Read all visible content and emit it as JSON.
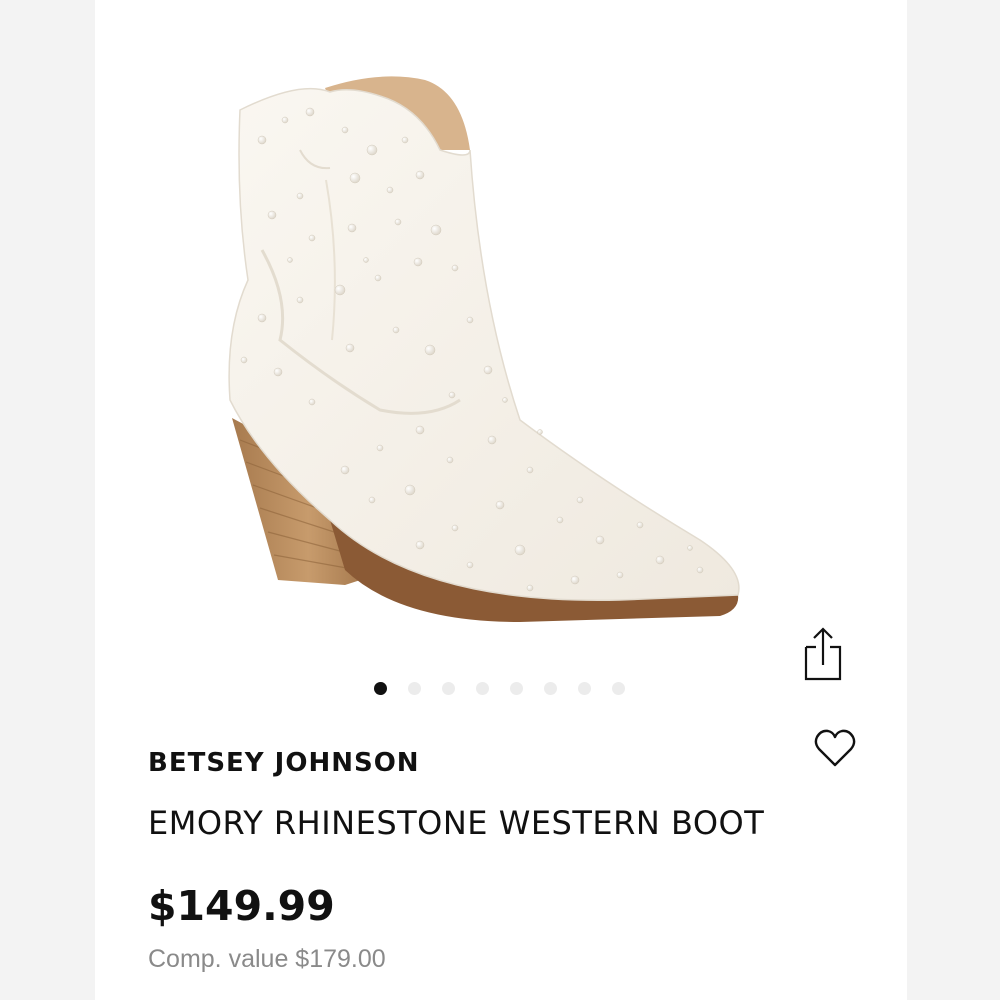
{
  "product": {
    "brand": "BETSEY JOHNSON",
    "name": "EMORY RHINESTONE WESTERN BOOT",
    "price": "$149.99",
    "comp_value": "Comp. value $179.00",
    "image_alt": "white rhinestone western boot"
  },
  "carousel": {
    "total": 8,
    "active_index": 0
  },
  "icons": {
    "share": "share-icon",
    "favorite": "heart-icon"
  },
  "colors": {
    "text": "#111111",
    "muted": "#8a8a8a",
    "dot_inactive": "#ececec",
    "dot_active": "#111111"
  }
}
